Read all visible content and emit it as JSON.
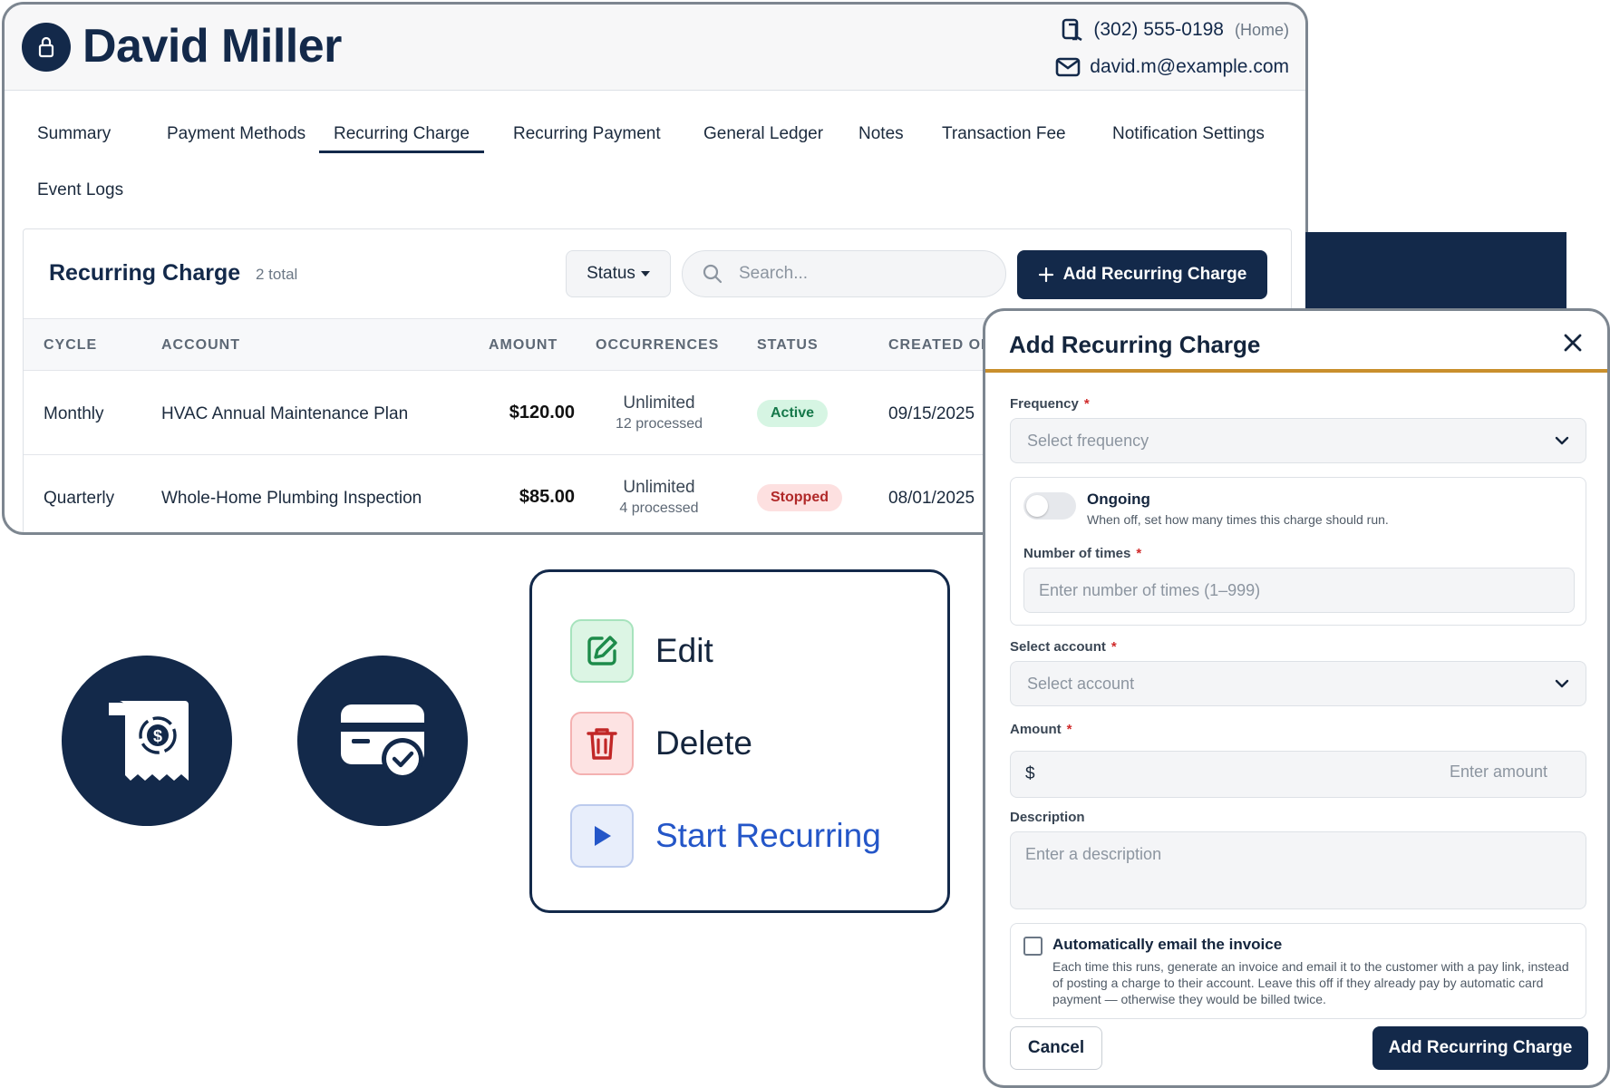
{
  "customer": {
    "name": "David Miller",
    "phone": "(302) 555-0198",
    "phone_type": "(Home)",
    "email": "david.m@example.com"
  },
  "tabs": [
    {
      "label": "Summary",
      "active": false
    },
    {
      "label": "Payment Methods",
      "active": false
    },
    {
      "label": "Recurring Charge",
      "active": true
    },
    {
      "label": "Recurring Payment",
      "active": false
    },
    {
      "label": "General Ledger",
      "active": false
    },
    {
      "label": "Notes",
      "active": false
    },
    {
      "label": "Transaction Fee",
      "active": false
    },
    {
      "label": "Notification Settings",
      "active": false
    },
    {
      "label": "Event Logs",
      "active": false
    }
  ],
  "recurring_charge": {
    "title": "Recurring Charge",
    "count": "2 total",
    "status_filter": "Status",
    "search_placeholder": "Search...",
    "add_button": "Add Recurring Charge",
    "columns": [
      "CYCLE",
      "ACCOUNT",
      "AMOUNT",
      "OCCURRENCES",
      "STATUS",
      "CREATED ON"
    ],
    "rows": [
      {
        "cycle": "Monthly",
        "account": "HVAC Annual Maintenance Plan",
        "amount": "$120.00",
        "occurrences": "Unlimited",
        "processed": "12 processed",
        "status": "Active",
        "created_on": "09/15/2025"
      },
      {
        "cycle": "Quarterly",
        "account": "Whole-Home Plumbing Inspection",
        "amount": "$85.00",
        "occurrences": "Unlimited",
        "processed": "4 processed",
        "status": "Stopped",
        "created_on": "08/01/2025"
      }
    ]
  },
  "feature_icons": [
    "receipt-dollar-icon",
    "card-check-icon"
  ],
  "action_menu": {
    "edit": "Edit",
    "delete": "Delete",
    "start": "Start Recurring"
  },
  "modal": {
    "title": "Add Recurring Charge",
    "frequency_label": "Frequency",
    "frequency_placeholder": "Select frequency",
    "ongoing_label": "Ongoing",
    "ongoing_help": "When off, set how many times this charge should run.",
    "ongoing_on": false,
    "times_label": "Number of times",
    "times_placeholder": "Enter number of times (1–999)",
    "account_label": "Select account",
    "account_placeholder": "Select account",
    "amount_label": "Amount",
    "currency": "$",
    "amount_placeholder": "Enter amount",
    "description_label": "Description",
    "description_placeholder": "Enter a description",
    "email_label": "Automatically email the invoice",
    "email_help": "Each time this runs, generate an invoice and email it to the customer with a pay link, instead of posting a charge to their account. Leave this off if they already pay by automatic card payment — otherwise they would be billed twice.",
    "email_checked": false,
    "cancel": "Cancel",
    "submit": "Add Recurring Charge"
  },
  "colors": {
    "navy": "#13294a",
    "accent": "#c98f2c",
    "active_badge": "#d6f5e3",
    "stopped_badge": "#fde0e0",
    "start_link": "#2456c8"
  }
}
